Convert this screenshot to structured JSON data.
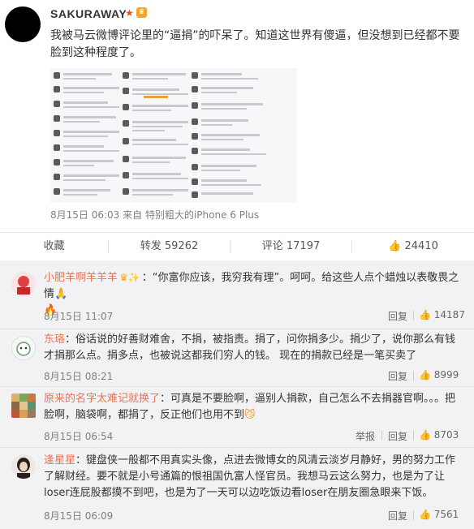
{
  "post": {
    "username": "SAKURAWAY",
    "text": "我被马云微博评论里的“逼捐”的吓呆了。知道这世界有傻逼，但没想到已经都不要脸到这种程度了。",
    "date": "8月15日 06:03",
    "source": "来自 特别粗大的iPhone 6 Plus"
  },
  "actions": {
    "favorite": "收藏",
    "repost": "转发 59262",
    "comment": "评论 17197",
    "like": "24410"
  },
  "comments": [
    {
      "name": "小肥羊啊羊羊羊",
      "text": "：“你富你应该，我穷我有理”。呵呵。给这些人点个蜡烛以表敬畏之情",
      "time": "8月15日 11:07",
      "reply": "回复",
      "likes": "14187"
    },
    {
      "name": "东珞",
      "text": "：俗话说的好善财难舍，不捐，被指责。捐了，问你捐多少。捐少了，说你那么有钱才捐那么点。捐多点，也被说这都我们穷人的钱。 现在的捐款已经是一笔买卖了",
      "time": "8月15日 08:21",
      "reply": "回复",
      "likes": "8999"
    },
    {
      "name": "原来的名字太难记就换了",
      "text": "：可真是不要脸啊，逼别人捐款，自己怎么不去捐器官啊。。。把脸啊，脑袋啊，都捐了，反正他们也用不到",
      "time": "8月15日 06:54",
      "report": "举报",
      "reply": "回复",
      "likes": "8703"
    },
    {
      "name": "逢星星",
      "text": "：键盘侠一般都不用真实头像，点进去微博女的风清云淡岁月静好，男的努力工作了解财经。要不就是小号通篇的恨祖国仇富人怪官员。我想马云这么努力，也是为了让loser连屁股都摸不到吧，也是为了一天可以边吃饭边看loser在朋友圈急眼来下饭。",
      "time": "8月15日 06:09",
      "reply": "回复",
      "likes": "7561"
    }
  ],
  "colors": {
    "name": "#eb7350",
    "meta": "#808080",
    "comment_bg": "#f2f2f5"
  }
}
